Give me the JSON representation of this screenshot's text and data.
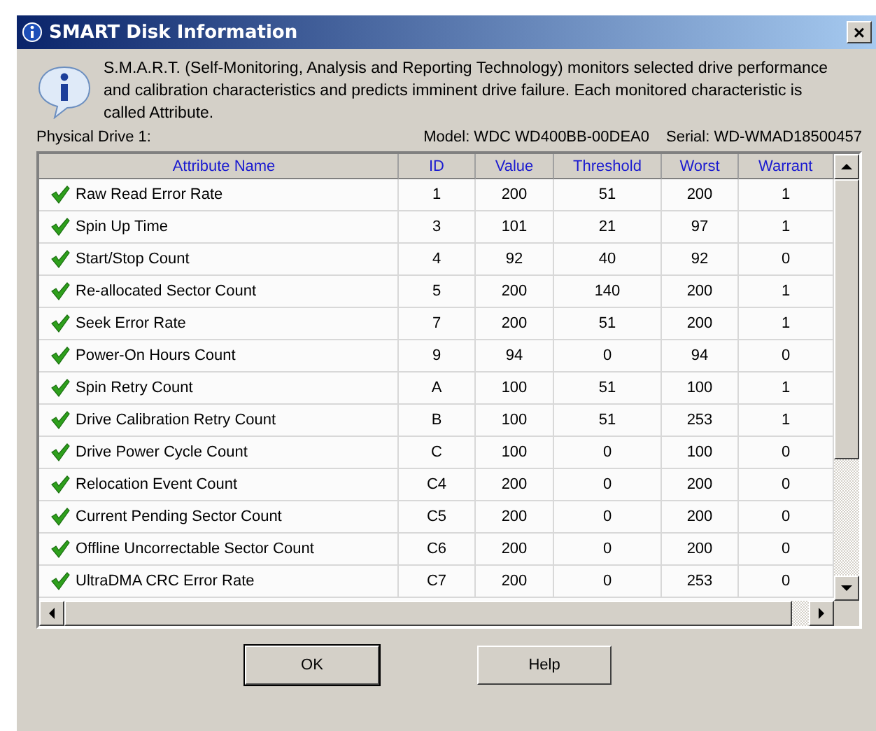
{
  "window": {
    "title": "SMART Disk Information",
    "close": "×"
  },
  "description": "S.M.A.R.T. (Self-Monitoring, Analysis and Reporting Technology) monitors selected drive performance and calibration characteristics and predicts imminent drive failure. Each monitored characteristic is called Attribute.",
  "drive": {
    "label": "Physical Drive 1:",
    "model": "Model: WDC WD400BB-00DEA0",
    "serial": "Serial: WD-WMAD18500457"
  },
  "table": {
    "columns": [
      "Attribute Name",
      "ID",
      "Value",
      "Threshold",
      "Worst",
      "Warrant"
    ],
    "rows": [
      [
        "Raw Read Error Rate",
        "1",
        "200",
        "51",
        "200",
        "1"
      ],
      [
        "Spin Up Time",
        "3",
        "101",
        "21",
        "97",
        "1"
      ],
      [
        "Start/Stop Count",
        "4",
        "92",
        "40",
        "92",
        "0"
      ],
      [
        "Re-allocated Sector Count",
        "5",
        "200",
        "140",
        "200",
        "1"
      ],
      [
        "Seek Error Rate",
        "7",
        "200",
        "51",
        "200",
        "1"
      ],
      [
        "Power-On Hours Count",
        "9",
        "94",
        "0",
        "94",
        "0"
      ],
      [
        "Spin Retry Count",
        "A",
        "100",
        "51",
        "100",
        "1"
      ],
      [
        "Drive Calibration Retry Count",
        "B",
        "100",
        "51",
        "253",
        "1"
      ],
      [
        "Drive Power Cycle Count",
        "C",
        "100",
        "0",
        "100",
        "0"
      ],
      [
        "Relocation Event Count",
        "C4",
        "200",
        "0",
        "200",
        "0"
      ],
      [
        "Current Pending Sector Count",
        "C5",
        "200",
        "0",
        "200",
        "0"
      ],
      [
        "Offline Uncorrectable Sector Count",
        "C6",
        "200",
        "0",
        "200",
        "0"
      ],
      [
        "UltraDMA CRC Error Rate",
        "C7",
        "200",
        "0",
        "253",
        "0"
      ]
    ]
  },
  "buttons": [
    {
      "label": "OK",
      "default": true
    },
    {
      "label": "Help",
      "default": false
    }
  ]
}
